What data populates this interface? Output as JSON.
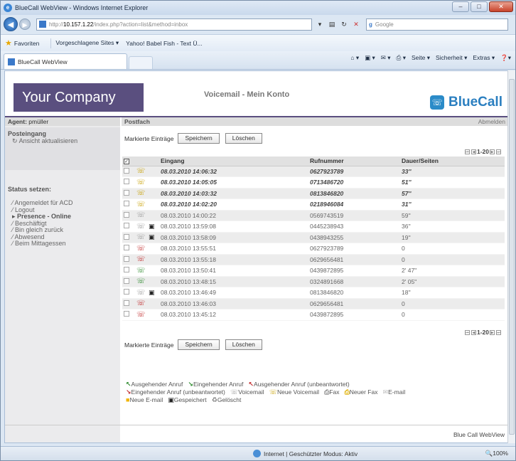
{
  "browser": {
    "window_title": "BlueCall WebView - Windows Internet Explorer",
    "url_prefix": "http://",
    "url_host": "10.157.1.22",
    "url_path": "/index.php?action=list&method=inbox",
    "search_engine": "Google",
    "favorites_label": "Favoriten",
    "favorites_items": [
      "Vorgeschlagene Sites ▾",
      "Yahoo! Babel Fish - Text Ü..."
    ],
    "tab_title": "BlueCall WebView",
    "commands": [
      "Seite ▾",
      "Sicherheit ▾",
      "Extras ▾",
      "❓▾"
    ],
    "status_text": "Internet | Geschützter Modus: Aktiv",
    "zoom": "🔍100%"
  },
  "app": {
    "company": "Your Company",
    "page_title": "Voicemail - Mein Konto",
    "brand": "BlueCall",
    "agent_label": "Agent:",
    "agent_name": "pmüller",
    "section_title": "Postfach",
    "logout": "Abmelden",
    "inbox_heading": "Posteingang",
    "refresh_label": "Ansicht aktualisieren",
    "status_heading": "Status setzen:",
    "statuses": [
      "Angemeldet für ACD",
      "Logout",
      "Presence - Online",
      "Beschäftigt",
      "Bin gleich zurück",
      "Abwesend",
      "Beim Mittagessen"
    ],
    "marked_label": "Markierte Einträge",
    "save_label": "Speichern",
    "delete_label": "Löschen",
    "pager": "1-20",
    "columns": [
      "Eingang",
      "Rufnummer",
      "Dauer/Seiten"
    ],
    "footer": "Blue Call WebView",
    "legend": [
      "Ausgehender Anruf",
      "Eingehender Anruf",
      "Ausgehender Anruf (unbeantwortet)",
      "Eingehender Anruf (unbeantwortet)",
      "Voicemail",
      "Neue Voicemail",
      "Fax",
      "Neuer Fax",
      "E-mail",
      "Neue E-mail",
      "Gespeichert",
      "Gelöscht"
    ]
  },
  "rows": [
    {
      "icon_color": "#c8a000",
      "date": "08.03.2010 14:06:32",
      "number": "0627923789",
      "duration": "33''",
      "unread": true,
      "saved": false
    },
    {
      "icon_color": "#c8a000",
      "date": "08.03.2010 14:05:05",
      "number": "0713486720",
      "duration": "51''",
      "unread": true,
      "saved": false
    },
    {
      "icon_color": "#c8a000",
      "date": "08.03.2010 14:03:32",
      "number": "0813846820",
      "duration": "57''",
      "unread": true,
      "saved": false
    },
    {
      "icon_color": "#c8a000",
      "date": "08.03.2010 14:02:20",
      "number": "0218946084",
      "duration": "31''",
      "unread": true,
      "saved": false
    },
    {
      "icon_color": "#999999",
      "date": "08.03.2010 14:00:22",
      "number": "0569743519",
      "duration": "59''",
      "unread": false,
      "saved": false
    },
    {
      "icon_color": "#999999",
      "date": "08.03.2010 13:59:08",
      "number": "0445238943",
      "duration": "36''",
      "unread": false,
      "saved": true
    },
    {
      "icon_color": "#999999",
      "date": "08.03.2010 13:58:09",
      "number": "0438943255",
      "duration": "19''",
      "unread": false,
      "saved": true
    },
    {
      "icon_color": "#c0292a",
      "date": "08.03.2010 13:55:51",
      "number": "0627923789",
      "duration": "0",
      "unread": false,
      "saved": false
    },
    {
      "icon_color": "#c0292a",
      "date": "08.03.2010 13:55:18",
      "number": "0629656481",
      "duration": "0",
      "unread": false,
      "saved": false
    },
    {
      "icon_color": "#2c8a2c",
      "date": "08.03.2010 13:50:41",
      "number": "0439872895",
      "duration": "2' 47''",
      "unread": false,
      "saved": false
    },
    {
      "icon_color": "#2c8a2c",
      "date": "08.03.2010 13:48:15",
      "number": "0324891668",
      "duration": "2' 05''",
      "unread": false,
      "saved": false
    },
    {
      "icon_color": "#999999",
      "date": "08.03.2010 13:46:49",
      "number": "0813846820",
      "duration": "18''",
      "unread": false,
      "saved": true
    },
    {
      "icon_color": "#c0292a",
      "date": "08.03.2010 13:46:03",
      "number": "0629656481",
      "duration": "0",
      "unread": false,
      "saved": false
    },
    {
      "icon_color": "#c0292a",
      "date": "08.03.2010 13:45:12",
      "number": "0439872895",
      "duration": "0",
      "unread": false,
      "saved": false
    }
  ]
}
